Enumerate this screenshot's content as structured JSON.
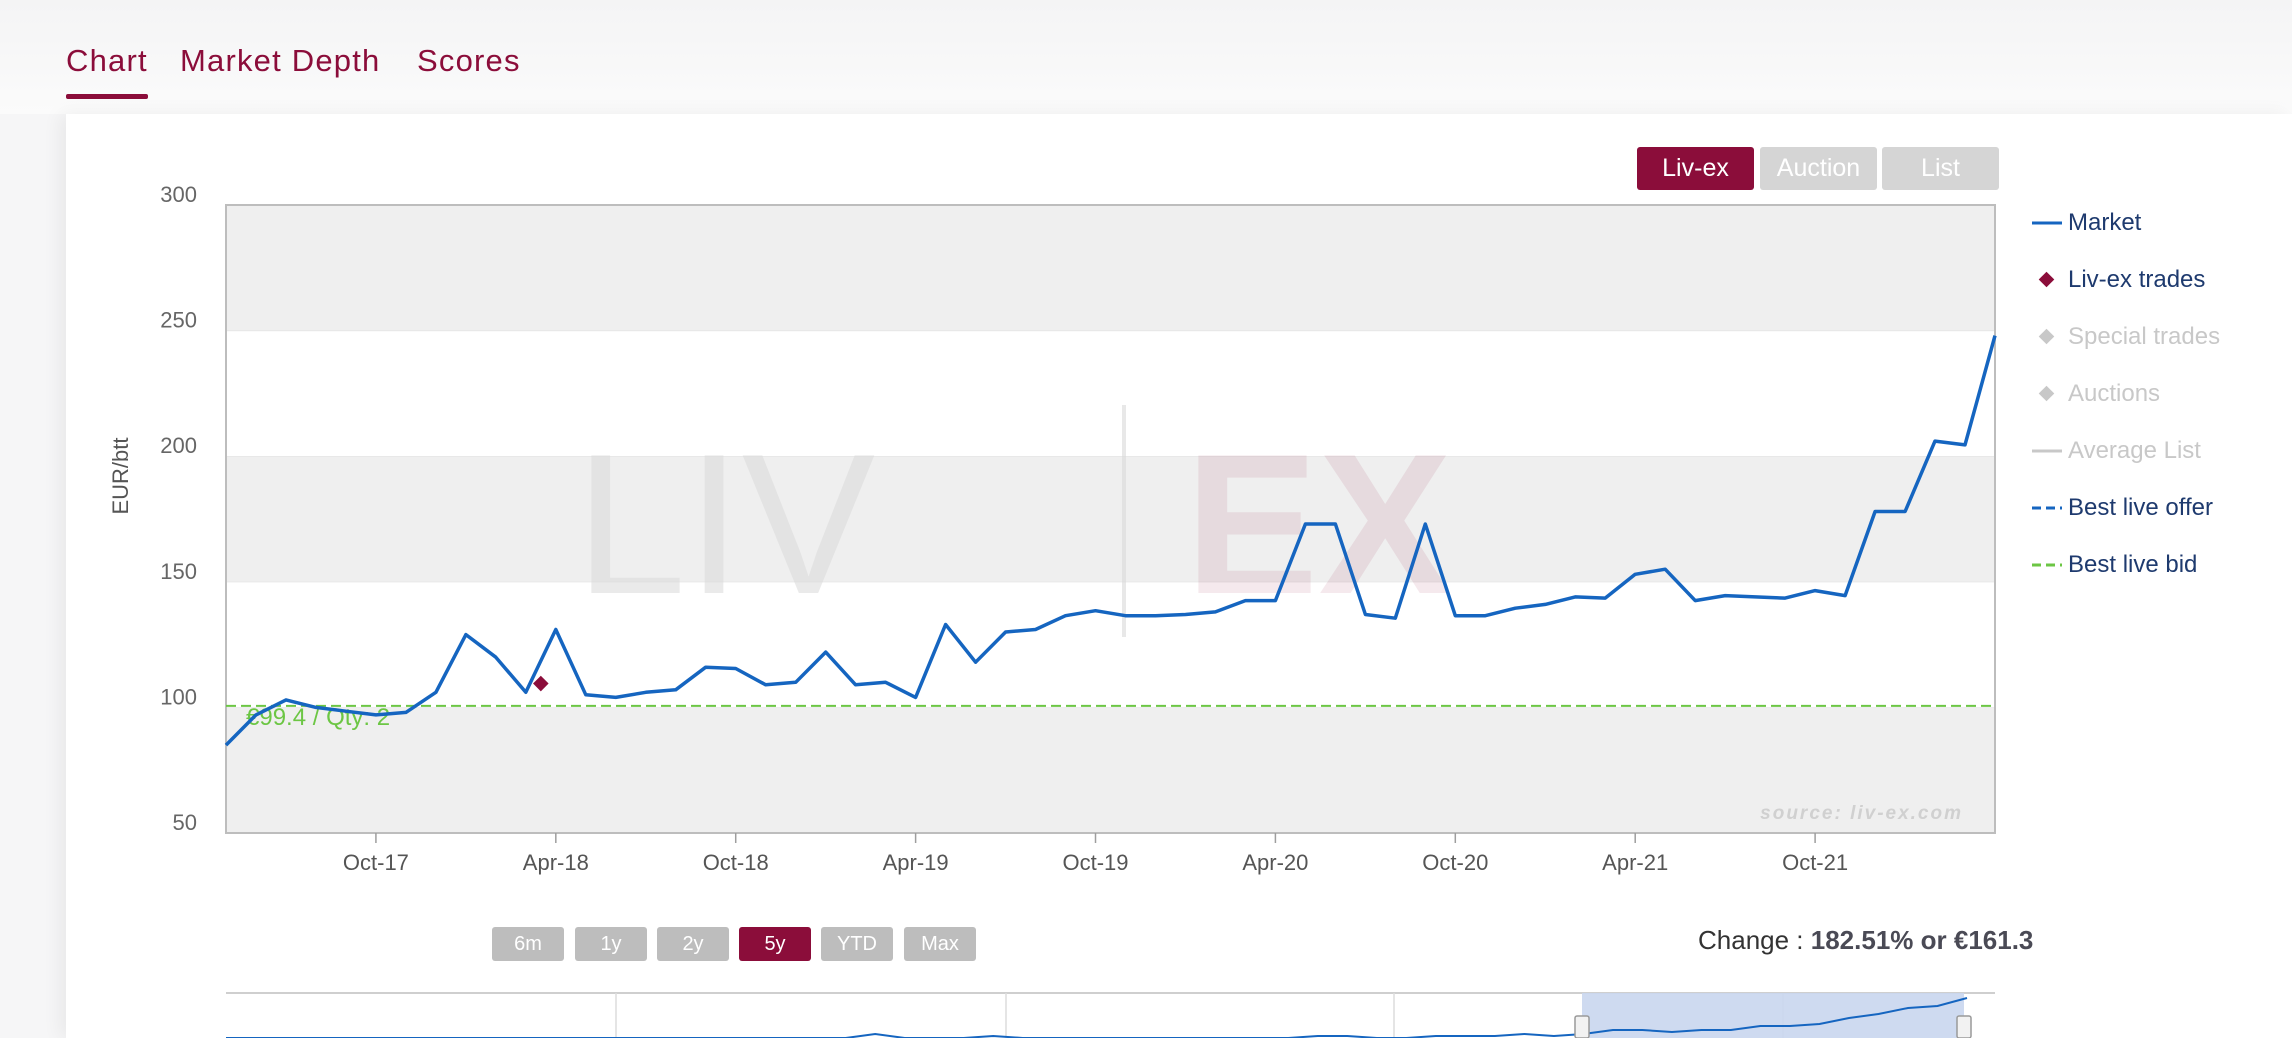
{
  "tabs": [
    {
      "label": "Chart",
      "active": true
    },
    {
      "label": "Market Depth",
      "active": false
    },
    {
      "label": "Scores",
      "active": false
    }
  ],
  "source_buttons": [
    {
      "label": "Liv-ex",
      "active": true
    },
    {
      "label": "Auction",
      "active": false
    },
    {
      "label": "List",
      "active": false
    }
  ],
  "legend": [
    {
      "label": "Market",
      "symbol": "line",
      "color": "#1565c0",
      "enabled": true
    },
    {
      "label": "Liv-ex trades",
      "symbol": "diamond",
      "color": "#8b0d3a",
      "enabled": true
    },
    {
      "label": "Special trades",
      "symbol": "diamond",
      "color": "#c8c8c8",
      "enabled": false
    },
    {
      "label": "Auctions",
      "symbol": "diamond",
      "color": "#c8c8c8",
      "enabled": false
    },
    {
      "label": "Average List",
      "symbol": "line",
      "color": "#c8c8c8",
      "enabled": false
    },
    {
      "label": "Best live offer",
      "symbol": "dashed",
      "color": "#1565c0",
      "enabled": true
    },
    {
      "label": "Best live bid",
      "symbol": "dashed",
      "color": "#6cc644",
      "enabled": true
    }
  ],
  "range_buttons": [
    {
      "label": "6m",
      "active": false
    },
    {
      "label": "1y",
      "active": false
    },
    {
      "label": "2y",
      "active": false
    },
    {
      "label": "5y",
      "active": true
    },
    {
      "label": "YTD",
      "active": false
    },
    {
      "label": "Max",
      "active": false
    }
  ],
  "change": {
    "label": "Change :",
    "value": "182.51% or €161.3"
  },
  "watermark": {
    "left": "LIV",
    "right": "EX"
  },
  "source_credit": "source: liv-ex.com",
  "colors": {
    "brand": "#8b0d3a",
    "market_line": "#1565c0",
    "bid_line": "#6cc644"
  },
  "chart_data": {
    "type": "line",
    "ylabel": "EUR/btt",
    "ylim": [
      50,
      300
    ],
    "yticks": [
      50,
      100,
      150,
      200,
      250,
      300
    ],
    "x_tick_labels": [
      "Oct-17",
      "Apr-18",
      "Oct-18",
      "Apr-19",
      "Oct-19",
      "Apr-20",
      "Oct-20",
      "Apr-21",
      "Oct-21"
    ],
    "x_tick_index": [
      5,
      11,
      17,
      23,
      29,
      35,
      41,
      47,
      53
    ],
    "x_count": 60,
    "grid": "alternating horizontal bands",
    "legend_position": "right",
    "series": [
      {
        "name": "Market",
        "values": [
          85,
          97,
          103,
          100,
          98.5,
          97,
          98,
          106,
          129,
          120,
          106,
          131,
          105,
          104,
          106,
          107,
          116,
          115.5,
          109,
          110,
          122,
          109,
          110,
          104,
          133,
          118,
          130,
          131,
          136.5,
          138.5,
          136.5,
          136.5,
          137,
          138,
          142.5,
          142.5,
          173,
          173,
          137,
          135.5,
          173,
          136.5,
          136.5,
          139.5,
          141,
          144,
          143.5,
          153,
          155,
          142.5,
          144.5,
          144,
          143.5,
          146.5,
          144.5,
          178,
          178,
          206,
          204.5,
          248
        ]
      },
      {
        "name": "Liv-ex trades",
        "points": [
          {
            "x": "Apr-18",
            "y": 109.5
          }
        ]
      },
      {
        "name": "Best live bid",
        "value": 99.4,
        "annotation": "€99.4 / Qty: 2"
      }
    ],
    "navigator_values": [
      0,
      0,
      0,
      0,
      0,
      0,
      0,
      0,
      0,
      0,
      0,
      0,
      0,
      0,
      0,
      0,
      0,
      0,
      0,
      0,
      0,
      0,
      2,
      0,
      0,
      0,
      1,
      0,
      0,
      0,
      0,
      0,
      0,
      0,
      0,
      0,
      0,
      1,
      1,
      0,
      0,
      1,
      1,
      1,
      2,
      1,
      2,
      4,
      4,
      3,
      4,
      4,
      6,
      6,
      7,
      10,
      12,
      15,
      16,
      20
    ]
  }
}
